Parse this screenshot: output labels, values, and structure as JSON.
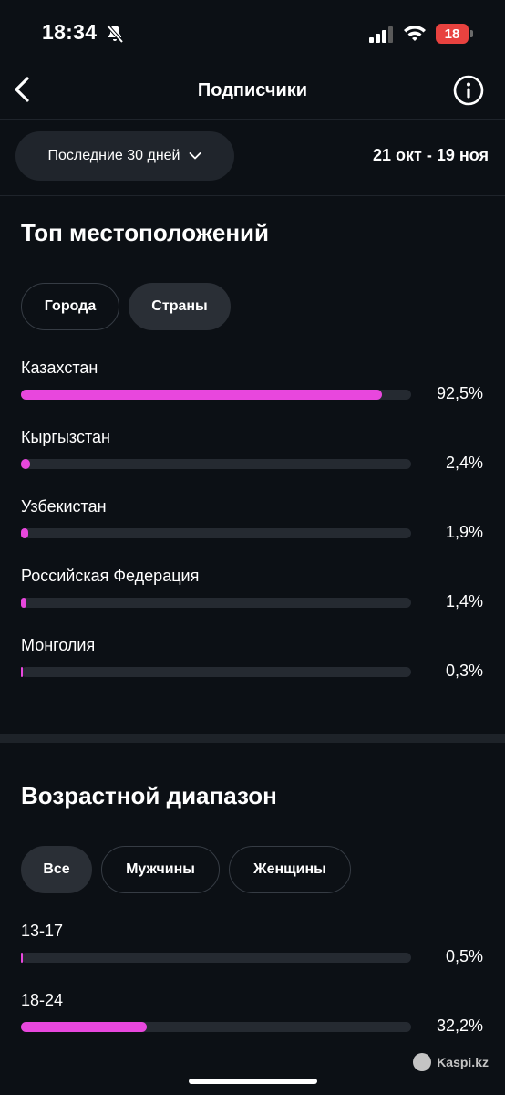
{
  "status_bar": {
    "time": "18:34",
    "battery": "18"
  },
  "header": {
    "title": "Подписчики"
  },
  "filter": {
    "range_label": "Последние 30 дней",
    "dates": "21 окт - 19 ноя"
  },
  "locations": {
    "title": "Топ местоположений",
    "chips": [
      "Города",
      "Страны"
    ],
    "selected_chip": "Страны",
    "rows": [
      {
        "label": "Казахстан",
        "value": 92.5,
        "pct": "92,5%"
      },
      {
        "label": "Кыргызстан",
        "value": 2.4,
        "pct": "2,4%"
      },
      {
        "label": "Узбекистан",
        "value": 1.9,
        "pct": "1,9%"
      },
      {
        "label": "Российская Федерация",
        "value": 1.4,
        "pct": "1,4%"
      },
      {
        "label": "Монголия",
        "value": 0.3,
        "pct": "0,3%"
      }
    ]
  },
  "age": {
    "title": "Возрастной диапазон",
    "chips": [
      "Все",
      "Мужчины",
      "Женщины"
    ],
    "selected_chip": "Все",
    "rows": [
      {
        "label": "13-17",
        "value": 0.5,
        "pct": "0,5%"
      },
      {
        "label": "18-24",
        "value": 32.2,
        "pct": "32,2%"
      }
    ]
  },
  "watermark": "Kaspi.kz",
  "colors": {
    "accent": "#e847dd",
    "background": "#0c1015",
    "track": "#252a31"
  }
}
